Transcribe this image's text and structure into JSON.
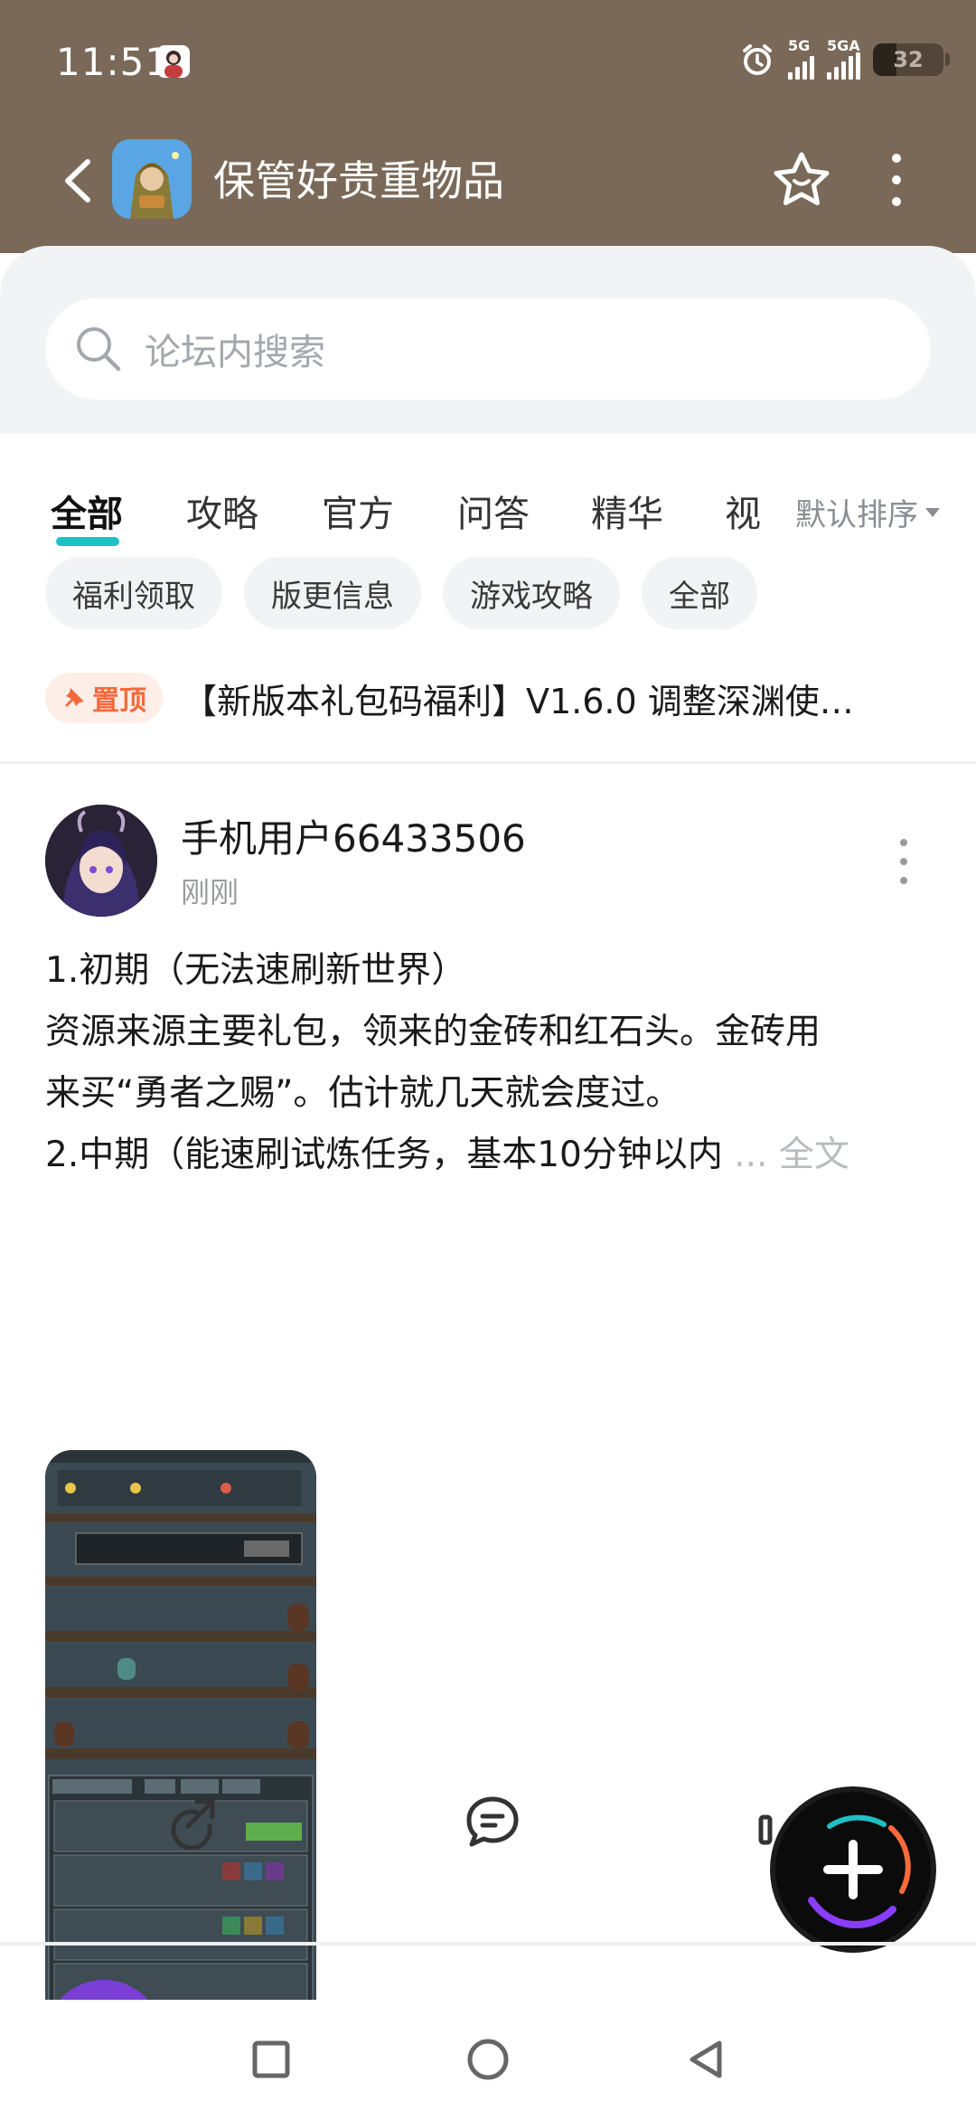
{
  "status_bar": {
    "time": "11:51",
    "network_1": "5G",
    "network_2": "5GA",
    "battery": "32"
  },
  "header": {
    "title": "保管好贵重物品"
  },
  "search": {
    "placeholder": "论坛内搜索"
  },
  "tabs": [
    {
      "label": "全部",
      "active": true
    },
    {
      "label": "攻略"
    },
    {
      "label": "官方"
    },
    {
      "label": "问答"
    },
    {
      "label": "精华"
    },
    {
      "label": "视"
    }
  ],
  "sort": {
    "label": "默认排序"
  },
  "chips": [
    "福利领取",
    "版更信息",
    "游戏攻略",
    "全部"
  ],
  "pinned": {
    "badge": "置顶",
    "title": "【新版本礼包码福利】V1.6.0 调整深渊使…"
  },
  "post": {
    "username": "手机用户66433506",
    "time": "刚刚",
    "lines": [
      "1.初期（无法速刷新世界）",
      "资源来源主要礼包，领来的金砖和红石头。金砖用",
      "来买“勇者之赐”。估计就几天就会度过。",
      "2.中期（能速刷试炼任务，基本10分钟以内"
    ],
    "ellipsis": "...",
    "read_more": "全文"
  },
  "colors": {
    "header_bg": "#7a6958",
    "accent": "#1ec0c3",
    "pin": "#f26a3c"
  }
}
